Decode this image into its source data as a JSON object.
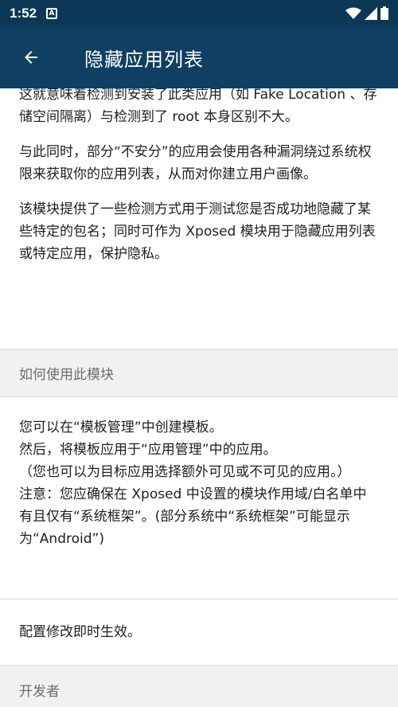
{
  "status_bar": {
    "time": "1:52",
    "notification_icon": "A"
  },
  "app_bar": {
    "title": "隐藏应用列表",
    "back_icon": "arrow-left-icon"
  },
  "intro": {
    "paragraphs": [
      "这就意味着检测到安装了此类应用（如 Fake Location 、存储空间隔离）与检测到了 root 本身区别不大。",
      "与此同时，部分“不安分”的应用会使用各种漏洞绕过系统权限来获取你的应用列表，从而对你建立用户画像。",
      "该模块提供了一些检测方式用于测试您是否成功地隐藏了某些特定的包名；同时可作为 Xposed 模块用于隐藏应用列表或特定应用，保护隐私。"
    ]
  },
  "how_to_use": {
    "header": "如何使用此模块",
    "lines": [
      "您可以在“模板管理”中创建模板。",
      "然后，将模板应用于“应用管理”中的应用。",
      "（您也可以为目标应用选择额外可见或不可见的应用。）",
      "注意：您应确保在 Xposed 中设置的模块作用域/白名单中有且仅有“系统框架”。(部分系统中“系统框架”可能显示为“Android”)"
    ],
    "note": "配置修改即时生效。"
  },
  "developer": {
    "header": "开发者"
  }
}
